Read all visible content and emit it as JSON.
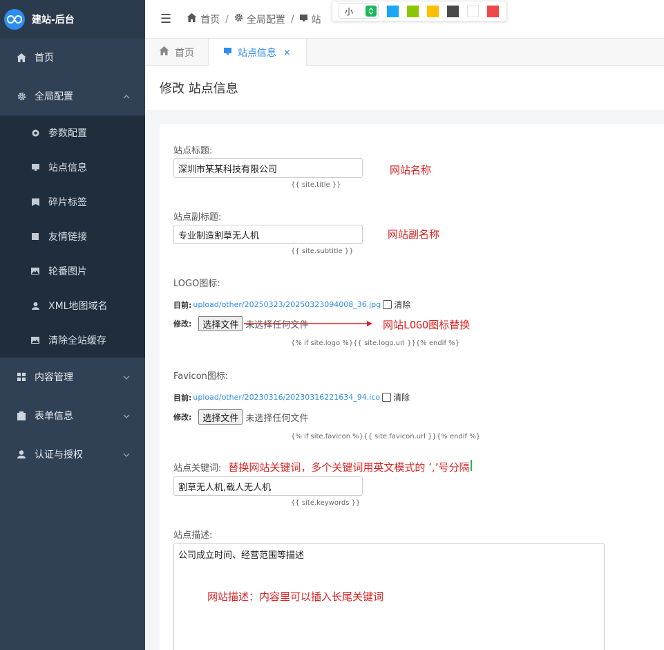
{
  "brand": {
    "title": "建站-后台"
  },
  "sidebar": {
    "home": "首页",
    "global": "全局配置",
    "sub_items": [
      "参数配置",
      "站点信息",
      "碎片标签",
      "友情链接",
      "轮番图片",
      "XML地图域名",
      "清除全站缓存"
    ],
    "content": "内容管理",
    "forms": "表单信息",
    "auth": "认证与授权"
  },
  "breadcrumb": {
    "home": "首页",
    "global": "全局配置",
    "current": "站"
  },
  "toolbar": {
    "size_value": "小",
    "swatches": [
      "#1aa7f5",
      "#8ac700",
      "#ffbf00",
      "#4a4a4a",
      "#ffffff",
      "#f04848"
    ]
  },
  "tabs": {
    "home": "首页",
    "active": "站点信息",
    "close": "×"
  },
  "page_title": "修改 站点信息",
  "form": {
    "title_label": "站点标题:",
    "title_value": "深圳市某某科技有限公司",
    "title_hint": "{{ site.title }}",
    "title_note": "网站名称",
    "subtitle_label": "站点副标题:",
    "subtitle_value": "专业制造割草无人机",
    "subtitle_hint": "{{ site.subtitle }}",
    "subtitle_note": "网站副名称",
    "logo_label": "LOGO图标:",
    "current_label": "目前:",
    "logo_path": "upload/other/20250323/20250323094008_36.jpg",
    "clear_label": "清除",
    "change_label": "修改:",
    "choose_file": "选择文件",
    "no_file": "未选择任何文件",
    "logo_hint": "{% if site.logo %}{{ site.logo.url }}{% endif %}",
    "logo_note": "网站LOGO图标替换",
    "favicon_label": "Favicon图标:",
    "favicon_path": "upload/other/20230316/20230316221634_94.ico",
    "favicon_hint": "{% if site.favicon %}{{ site.favicon.url }}{% endif %}",
    "keywords_label": "站点关键词:",
    "keywords_note": "替换网站关键词，多个关键词用英文模式的 ’,’号分隔",
    "keywords_value": "割草无人机,载人无人机",
    "keywords_hint": "{{ site.keywords }}",
    "desc_label": "站点描述:",
    "desc_value": "公司成立时间、经营范围等描述",
    "desc_note": "网站描述：内容里可以插入长尾关键词"
  },
  "colors": {
    "accent": "#2d8cf0",
    "sidebar_bg": "#304156",
    "submenu_bg": "#1f2d3d",
    "note_red": "#dd2222"
  }
}
